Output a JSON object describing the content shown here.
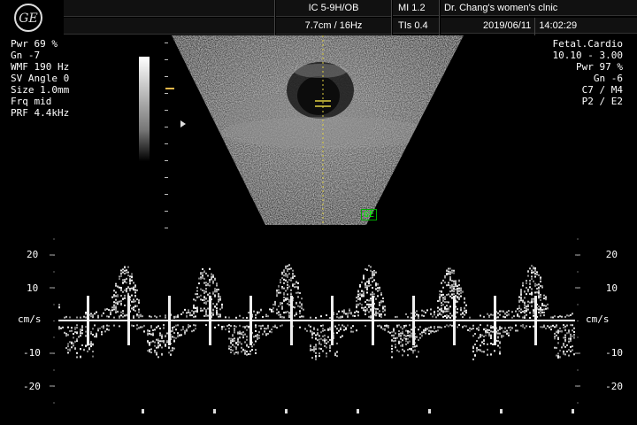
{
  "header": {
    "probe": "IC 5-9H/OB",
    "depth_freq": "7.7cm / 16Hz",
    "mi": "MI  1.2",
    "tis": "TIs  0.4",
    "clinic": "Dr. Chang's women's clnic",
    "date": "2019/06/11",
    "time": "14:02:29",
    "logo_text": "GE"
  },
  "left_params": [
    "Pwr  69 %",
    "Gn  -7",
    "WMF 190 Hz",
    "SV Angle  0",
    "Size  1.0mm",
    "Frq mid",
    "PRF  4.4kHz"
  ],
  "right_params": [
    "Fetal.Cardio",
    "10.10 - 3.00",
    "Pwr  97 %",
    "Gn  -6",
    "C7 / M4",
    "P2 / E2"
  ],
  "scan_badge": "GE",
  "doppler": {
    "unit_left": "cm/s",
    "unit_right": "cm/s",
    "ticks": [
      {
        "label": "20",
        "value": 20
      },
      {
        "label": "10",
        "value": 10
      },
      {
        "label": "-10",
        "value": -10
      },
      {
        "label": "-20",
        "value": -20
      }
    ]
  },
  "colors": {
    "focus_marker": "#e9b84a",
    "sample_gate": "#e0d040",
    "badge": "#00ff00",
    "baseline": "#ffffff"
  }
}
